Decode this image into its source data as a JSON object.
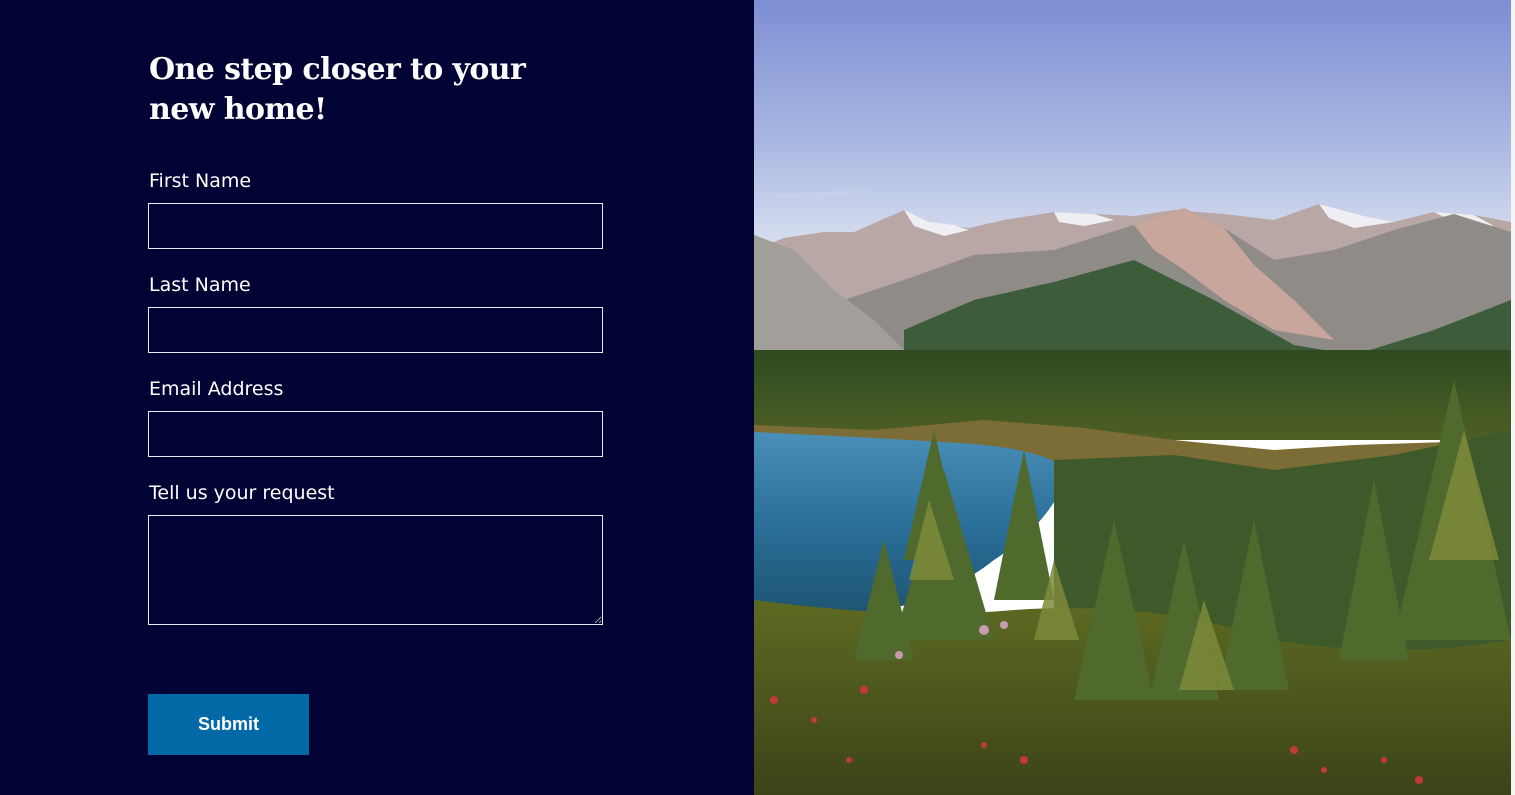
{
  "form": {
    "heading": "One step closer to your new home!",
    "fields": [
      {
        "label": "First Name",
        "value": "",
        "placeholder": ""
      },
      {
        "label": "Last Name",
        "value": "",
        "placeholder": ""
      },
      {
        "label": "Email Address",
        "value": "",
        "placeholder": ""
      },
      {
        "label": "Tell us your request",
        "value": "",
        "placeholder": ""
      }
    ],
    "submit_label": "Submit"
  },
  "colors": {
    "panel_background": "#000333",
    "field_border": "#e9e9f2",
    "submit_background": "#0069a6",
    "text": "#ffffff"
  },
  "image": {
    "subject": "mountain-lake-landscape"
  }
}
